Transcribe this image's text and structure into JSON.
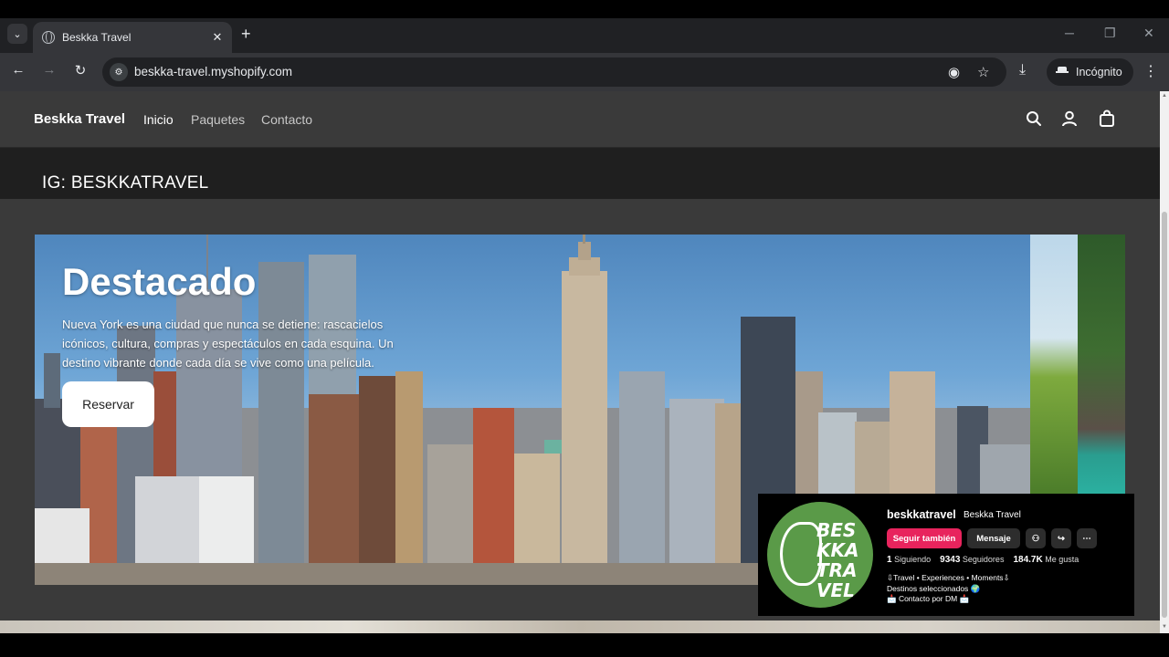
{
  "browser": {
    "tab_title": "Beskka Travel",
    "tab_close": "✕",
    "new_tab": "+",
    "url": "beskka-travel.myshopify.com",
    "profile_label": "Incógnito"
  },
  "site": {
    "brand": "Beskka Travel",
    "nav": [
      "Inicio",
      "Paquetes",
      "Contacto"
    ],
    "banner_text": "IG: BESKKATRAVEL"
  },
  "hero": {
    "title": "Destacado",
    "description": "Nueva York es una ciudad que nunca se detiene: rascacielos icónicos, cultura, compras y espectáculos en cada esquina. Un destino vibrante donde cada día se vive como una película.",
    "button": "Reservar"
  },
  "instagram": {
    "username": "beskkatravel",
    "display_name": "Beskka Travel",
    "avatar_text": [
      "BES",
      "KKA",
      "TRA",
      "VEL"
    ],
    "follow_button": "Seguir también",
    "message_button": "Mensaje",
    "following_count": "1",
    "following_label": "Siguiendo",
    "followers_count": "9343",
    "followers_label": "Seguidores",
    "likes_count": "184.7K",
    "likes_label": "Me gusta",
    "bio": [
      "⇩Travel • Experiences • Moments⇩",
      "Destinos seleccionados 🌍",
      "📩 Contacto por DM 📩"
    ]
  },
  "colors": {
    "accent_follow": "#e8245d",
    "avatar_green": "#5a9a48"
  }
}
